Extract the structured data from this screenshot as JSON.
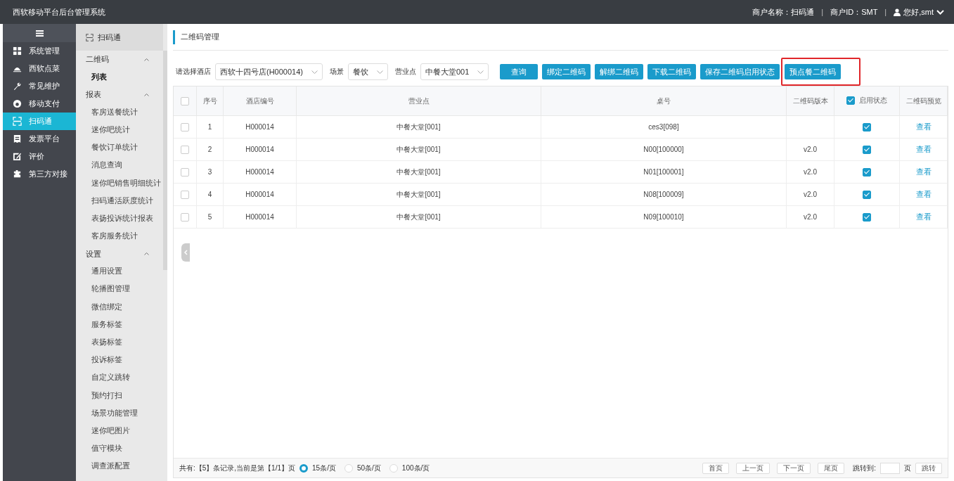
{
  "header": {
    "title": "西软移动平台后台管理系统",
    "segments": [
      {
        "kind": "text",
        "text": "商户名称：扫码通"
      },
      {
        "kind": "separator",
        "text": "|"
      },
      {
        "kind": "text",
        "text": "商户ID：SMT"
      },
      {
        "kind": "separator",
        "text": "|"
      }
    ],
    "user": "您好,smt"
  },
  "nav": {
    "items": [
      {
        "label": "系统管理",
        "selected": false
      },
      {
        "label": "西软点菜",
        "selected": false
      },
      {
        "label": "常见维护",
        "selected": false
      },
      {
        "label": "移动支付",
        "selected": false
      },
      {
        "label": "扫码通",
        "selected": true
      },
      {
        "label": "发票平台",
        "selected": false
      },
      {
        "label": "评价",
        "selected": false
      },
      {
        "label": "第三方对接",
        "selected": false
      }
    ]
  },
  "submenu": {
    "title": "扫码通",
    "groups": [
      {
        "label": "二维码",
        "expanded": true,
        "items": [
          {
            "label": "列表",
            "selected": true
          }
        ]
      },
      {
        "label": "报表",
        "expanded": true,
        "items": [
          {
            "label": "客房送餐统计",
            "selected": false
          },
          {
            "label": "迷你吧统计",
            "selected": false
          },
          {
            "label": "餐饮订单统计",
            "selected": false
          },
          {
            "label": "消息查询",
            "selected": false
          },
          {
            "label": "迷你吧销售明细统计",
            "selected": false
          },
          {
            "label": "扫码通活跃度统计",
            "selected": false
          },
          {
            "label": "表扬投诉统计报表",
            "selected": false
          },
          {
            "label": "客房服务统计",
            "selected": false
          }
        ]
      },
      {
        "label": "设置",
        "expanded": true,
        "items": [
          {
            "label": "通用设置",
            "selected": false
          },
          {
            "label": "轮播图管理",
            "selected": false
          },
          {
            "label": "微信绑定",
            "selected": false
          },
          {
            "label": "服务标签",
            "selected": false
          },
          {
            "label": "表扬标签",
            "selected": false
          },
          {
            "label": "投诉标签",
            "selected": false
          },
          {
            "label": "自定义跳转",
            "selected": false
          },
          {
            "label": "预约打扫",
            "selected": false
          },
          {
            "label": "场景功能管理",
            "selected": false
          },
          {
            "label": "迷你吧图片",
            "selected": false
          },
          {
            "label": "值守模块",
            "selected": false
          },
          {
            "label": "调查派配置",
            "selected": false
          }
        ]
      }
    ]
  },
  "breadcrumb": "二维码管理",
  "filters": [
    {
      "label": "请选择酒店",
      "value": "西软十四号店(H000014)"
    },
    {
      "label": "场景",
      "value": "餐饮"
    },
    {
      "label": "营业点",
      "value": "中餐大堂001"
    }
  ],
  "buttons": [
    {
      "label": "查询",
      "highlighted": false
    },
    {
      "label": "绑定二维码",
      "highlighted": false
    },
    {
      "label": "解绑二维码",
      "highlighted": false
    },
    {
      "label": "下载二维码",
      "highlighted": false
    },
    {
      "label": "保存二维码启用状态",
      "highlighted": false
    },
    {
      "label": "预点餐二维码",
      "highlighted": true
    }
  ],
  "table": {
    "columns": [
      {
        "kind": "checkbox",
        "checked": false
      },
      {
        "kind": "text",
        "label": "序号"
      },
      {
        "kind": "text",
        "label": "酒店编号"
      },
      {
        "kind": "text",
        "label": "营业点"
      },
      {
        "kind": "text",
        "label": "桌号"
      },
      {
        "kind": "text",
        "label": "二维码版本"
      },
      {
        "kind": "check-label",
        "label": "启用状态",
        "checked": true
      },
      {
        "kind": "text",
        "label": "二维码预览"
      }
    ],
    "rows": [
      {
        "selected": false,
        "no": "1",
        "hotel": "H000014",
        "outlet": "中餐大堂[001]",
        "table": "ces3[098]",
        "enabled": true,
        "preview": "查看"
      },
      {
        "selected": false,
        "no": "2",
        "hotel": "H000014",
        "outlet": "中餐大堂[001]",
        "table": "N00[100000]",
        "version": "v2.0",
        "enabled": true,
        "preview": "查看"
      },
      {
        "selected": false,
        "no": "3",
        "hotel": "H000014",
        "outlet": "中餐大堂[001]",
        "table": "N01[100001]",
        "version": "v2.0",
        "enabled": true,
        "preview": "查看"
      },
      {
        "selected": false,
        "no": "4",
        "hotel": "H000014",
        "outlet": "中餐大堂[001]",
        "table": "N08[100009]",
        "version": "v2.0",
        "enabled": true,
        "preview": "查看"
      },
      {
        "selected": false,
        "no": "5",
        "hotel": "H000014",
        "outlet": "中餐大堂[001]",
        "table": "N09[100010]",
        "version": "v2.0",
        "enabled": true,
        "preview": "查看"
      }
    ]
  },
  "footer": {
    "summary": "共有:【5】条记录,当前是第【1/1】页",
    "page_sizes": [
      {
        "label": "15条/页",
        "selected": true
      },
      {
        "label": "50条/页",
        "selected": false
      },
      {
        "label": "100条/页",
        "selected": false
      }
    ],
    "pager": [
      "首页",
      "上一页",
      "下一页",
      "尾页"
    ],
    "jump_label": "跳转到:",
    "page_unit": "页",
    "jump_button": "跳转"
  }
}
